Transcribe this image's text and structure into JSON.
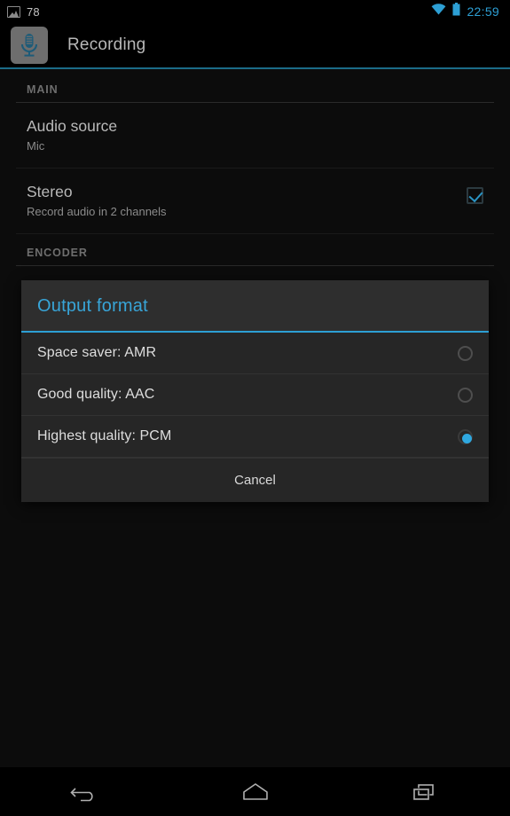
{
  "status_bar": {
    "notification_icon": "image-icon",
    "notification_count": "78",
    "wifi_icon": "wifi-icon",
    "battery_icon": "battery-icon",
    "clock": "22:59"
  },
  "action_bar": {
    "app_icon": "microphone-icon",
    "title": "Recording",
    "accent_color": "#2d9fd4"
  },
  "settings": {
    "sections": [
      {
        "header": "MAIN",
        "rows": [
          {
            "title": "Audio source",
            "subtitle": "Mic",
            "control": "none"
          },
          {
            "title": "Stereo",
            "subtitle": "Record audio in 2 channels",
            "control": "checkbox",
            "checked": true
          }
        ]
      },
      {
        "header": "ENCODER",
        "rows": [
          {
            "title": "Output format",
            "subtitle": "Highest quality: PCM",
            "control": "none"
          }
        ]
      }
    ]
  },
  "dialog": {
    "title": "Output format",
    "title_color": "#38a5d8",
    "options": [
      {
        "label": "Space saver: AMR",
        "selected": false
      },
      {
        "label": "Good quality: AAC",
        "selected": false
      },
      {
        "label": "Highest quality: PCM",
        "selected": true
      }
    ],
    "cancel_label": "Cancel"
  },
  "nav_bar": {
    "back_icon": "back-arrow-icon",
    "home_icon": "home-icon",
    "recents_icon": "recents-icon"
  }
}
